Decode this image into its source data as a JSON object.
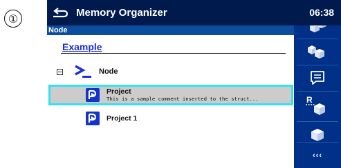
{
  "marker": "①",
  "header": {
    "title": "Memory Organizer",
    "time": "06:38"
  },
  "path": {
    "label": "Node"
  },
  "tree": {
    "root_label": "Example",
    "node": {
      "label": "Node"
    },
    "items": [
      {
        "title": "Project",
        "comment": "This is a sample comment inserted to the struct...",
        "selected": true
      },
      {
        "title": "Project 1",
        "comment": "",
        "selected": false
      }
    ]
  },
  "sidebar": {
    "buttons": [
      {
        "icon": "boxes-partial-icon"
      },
      {
        "icon": "boxes-icon"
      },
      {
        "icon": "comment-icon"
      },
      {
        "icon": "recall-box-icon",
        "label": "R"
      },
      {
        "icon": "box-icon"
      }
    ],
    "more_label": "‹‹‹"
  },
  "colors": {
    "header": "#001a4d",
    "path_bar": "#0d4d9e",
    "sidebar": "#003087",
    "selection_border": "#36e0ef",
    "heading": "#1a2fd6"
  }
}
